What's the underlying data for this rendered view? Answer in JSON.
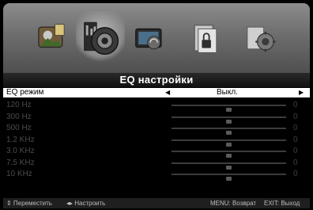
{
  "icons": [
    {
      "name": "picture-icon",
      "label": ""
    },
    {
      "name": "sound-icon",
      "label": "",
      "active": true
    },
    {
      "name": "channel-icon",
      "label": ""
    },
    {
      "name": "lock-icon",
      "label": ""
    },
    {
      "name": "setup-icon",
      "label": ""
    }
  ],
  "title": "EQ настройки",
  "eq_mode": {
    "label": "EQ режим",
    "value": "Выкл."
  },
  "bands": [
    {
      "label": "120 Hz",
      "value": "0",
      "level": 0.5
    },
    {
      "label": "300 Hz",
      "value": "0",
      "level": 0.5
    },
    {
      "label": "500 Hz",
      "value": "0",
      "level": 0.5
    },
    {
      "label": "1.2 KHz",
      "value": "0",
      "level": 0.5
    },
    {
      "label": "3.0 KHz",
      "value": "0",
      "level": 0.5
    },
    {
      "label": "7.5 KHz",
      "value": "0",
      "level": 0.5
    },
    {
      "label": "10 KHz",
      "value": "0",
      "level": 0.5
    }
  ],
  "hints": {
    "move": "⇕ Переместить",
    "adjust": "◂▸ Настроить",
    "menu": "MENU: Возврат",
    "exit": "EXIT: Выход"
  },
  "colors": {
    "selected_row": "#ffffff",
    "background": "#000000",
    "dim_text": "#4b4b4b"
  }
}
